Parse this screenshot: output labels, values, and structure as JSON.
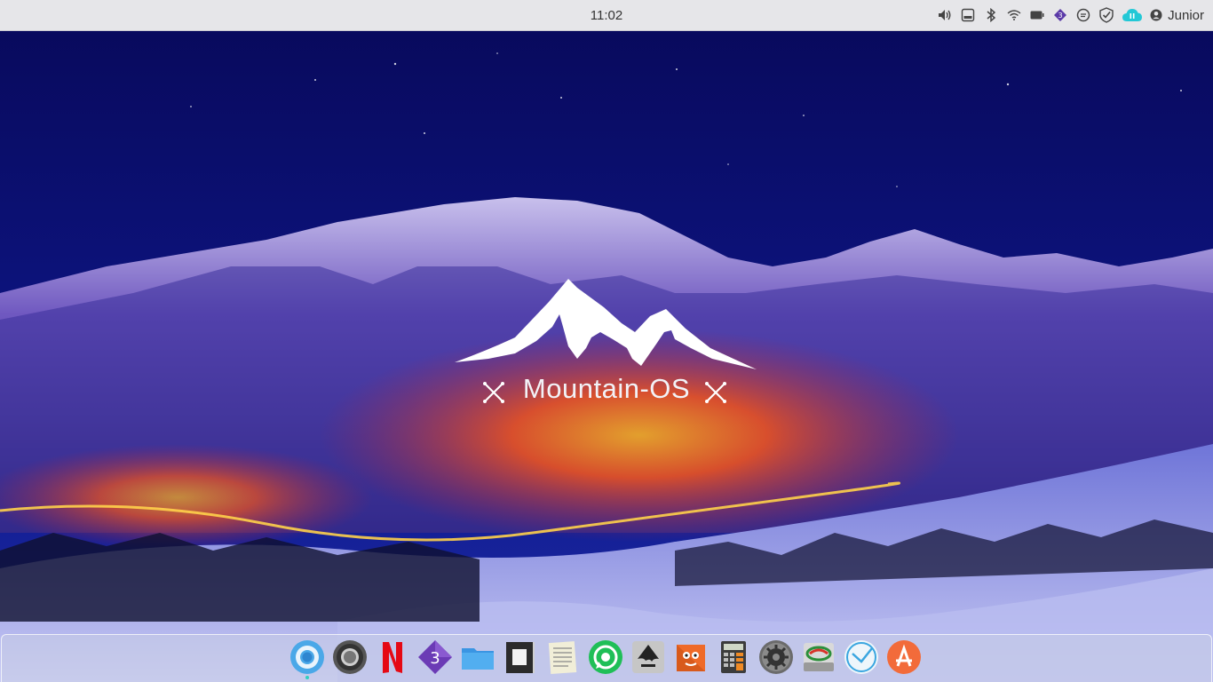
{
  "topbar": {
    "clock": "11:02",
    "user_name": "Junior",
    "tray_icons": [
      "volume-icon",
      "drive-icon",
      "bluetooth-icon",
      "wifi-icon",
      "battery-icon",
      "app-3-icon",
      "chat-icon",
      "shield-check-icon",
      "cloud-sync-icon",
      "user-icon"
    ]
  },
  "desktop": {
    "logo_text": "Mountain-OS"
  },
  "dock": {
    "apps": [
      {
        "name": "chromium",
        "icon": "chromium-icon"
      },
      {
        "name": "chrome",
        "icon": "chrome-icon"
      },
      {
        "name": "netflix",
        "icon": "netflix-icon",
        "label": "N"
      },
      {
        "name": "app-3",
        "icon": "app-3-icon",
        "label": "3"
      },
      {
        "name": "files",
        "icon": "folder-icon"
      },
      {
        "name": "notes",
        "icon": "document-icon"
      },
      {
        "name": "text-editor",
        "icon": "text-editor-icon"
      },
      {
        "name": "whatsapp",
        "icon": "whatsapp-icon"
      },
      {
        "name": "inkscape",
        "icon": "inkscape-icon"
      },
      {
        "name": "gimp",
        "icon": "gimp-icon"
      },
      {
        "name": "calculator",
        "icon": "calculator-icon"
      },
      {
        "name": "settings",
        "icon": "gear-icon"
      },
      {
        "name": "disk-utility",
        "icon": "disk-utility-icon"
      },
      {
        "name": "clock",
        "icon": "clock-icon"
      },
      {
        "name": "app-store",
        "icon": "app-store-icon"
      }
    ]
  },
  "colors": {
    "topbar_bg": "#e6e6e9",
    "sky_top": "#0a0d5a",
    "accent_cyan": "#2fd0c0",
    "netflix_red": "#e50914",
    "app_store_orange": "#f26b3a"
  }
}
